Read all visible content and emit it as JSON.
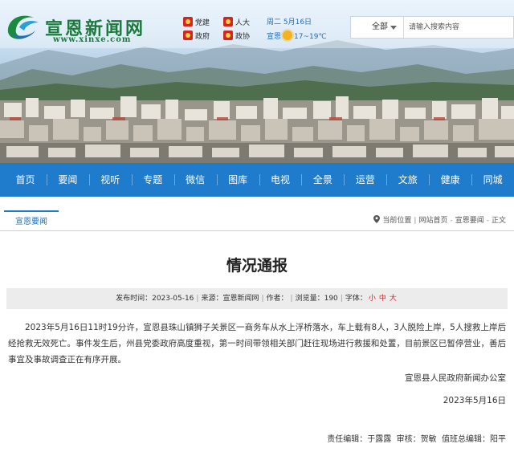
{
  "site": {
    "name": "宣恩新闻网",
    "url": "www.xinxe.com"
  },
  "toplinks": {
    "party": "党建",
    "npc": "人大",
    "gov": "政府",
    "cppcc": "政协",
    "date": "周二 5月16日",
    "city": "宣恩",
    "temp": "17~19℃"
  },
  "search": {
    "category": "全部",
    "placeholder": "请输入搜索内容"
  },
  "nav": [
    "首页",
    "要闻",
    "视听",
    "专题",
    "微信",
    "图库",
    "电视",
    "全景",
    "运营",
    "文旅",
    "健康",
    "同城"
  ],
  "breadcrumb": {
    "section": "宣恩要闻",
    "current_label": "当前位置",
    "home": "网站首页",
    "category": "宣恩要闻",
    "page": "正文"
  },
  "article": {
    "title": "情况通报",
    "meta": {
      "publish_label": "发布时间：",
      "publish_date": "2023-05-16",
      "source_label": "来源：",
      "source": "宣恩新闻网",
      "author_label": "作者：",
      "views_label": "浏览量：",
      "views": "190",
      "fontsize_label": "字体：",
      "font_small": "小",
      "font_medium": "中",
      "font_large": "大"
    },
    "body": "2023年5月16日11时19分许，宣恩县珠山镇狮子关景区一商务车从水上浮桥落水，车上载有8人，3人脱险上岸，5人搜救上岸后经抢救无效死亡。事件发生后，州县党委政府高度重视，第一时间带领相关部门赶往现场进行救援和处置，目前景区已暂停营业，善后事宜及事故调查正在有序开展。",
    "signature": "宣恩县人民政府新闻办公室",
    "sign_date": "2023年5月16日",
    "editors": {
      "editor_label": "责任编辑：",
      "editor": "于露露",
      "reviewer_label": "审核：",
      "reviewer": "贺敏",
      "chief_label": "值班总编辑：",
      "chief": "阳平"
    }
  }
}
